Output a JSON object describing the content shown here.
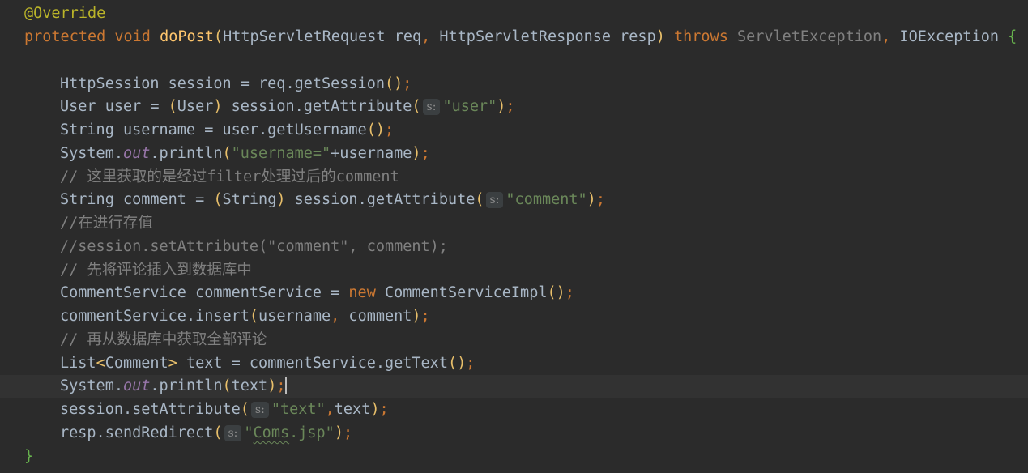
{
  "editor": {
    "theme_colors": {
      "background": "#2b2b2b",
      "current_line": "#323232",
      "keyword": "#cc7832",
      "string": "#6a8759",
      "comment": "#808080",
      "annotation": "#bbb529",
      "method_declaration": "#ffc66d",
      "static_field": "#9876aa",
      "default_text": "#a9b7c6"
    },
    "lines": [
      {
        "annotation": "@Override"
      },
      {
        "kw_protected": "protected",
        "kw_void": "void",
        "method": "doPost",
        "param1_type": "HttpServletRequest",
        "param1_name": "req",
        "param2_type": "HttpServletResponse",
        "param2_name": "resp",
        "kw_throws": "throws",
        "exc1": "ServletException",
        "exc2": "IOException"
      },
      {},
      {
        "a": "HttpSession session = req.getSession"
      },
      {
        "a": "User user = ",
        "b": "User",
        "c": " session.getAttribute",
        "hint": "s:",
        "str": "\"user\""
      },
      {
        "a": "String username = user.getUsername"
      },
      {
        "a": "System.",
        "field": "out",
        "b": ".println",
        "str": "\"username=\"",
        "c": "+username"
      },
      {
        "comment": "// 这里获取的是经过filter处理过后的comment"
      },
      {
        "a": "String comment = ",
        "b": "String",
        "c": " session.getAttribute",
        "hint": "s:",
        "str": "\"comment\""
      },
      {
        "comment": "//在进行存值"
      },
      {
        "comment": "//session.setAttribute(\"comment\", comment);"
      },
      {
        "comment": "// 先将评论插入到数据库中"
      },
      {
        "a": "CommentService commentService = ",
        "kw": "new",
        "b": " CommentServiceImpl"
      },
      {
        "a": "commentService.insert",
        "b": "username",
        "c": " comment"
      },
      {
        "comment": "// 再从数据库中获取全部评论"
      },
      {
        "a": "List",
        "b": "Comment",
        "c": " text = commentService.getText"
      },
      {
        "a": "System.",
        "field": "out",
        "b": ".println",
        "c": "text"
      },
      {
        "a": "session.setAttribute",
        "hint": "s:",
        "str": "\"text\"",
        "b": "text"
      },
      {
        "a": "resp.sendRedirect",
        "hint": "s:",
        "str_pre": "\"",
        "str_sq": "Coms",
        "str_post": ".jsp\""
      },
      {
        "brace": "}"
      }
    ]
  }
}
